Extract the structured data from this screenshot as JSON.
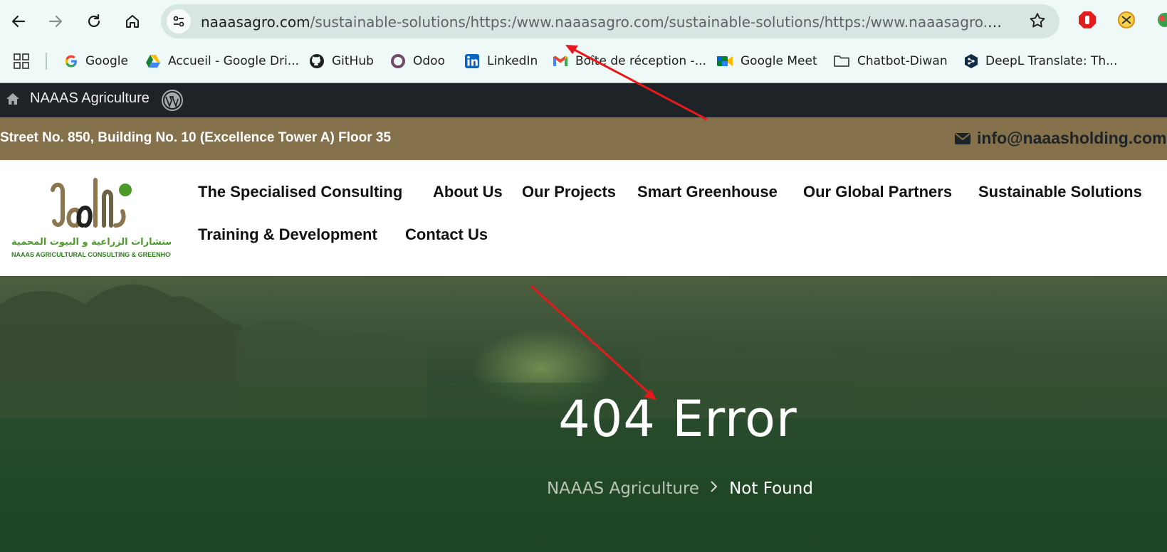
{
  "browser": {
    "url_host": "naaasagro.com",
    "url_path": "/sustainable-solutions/https:/www.naaasagro.com/sustainable-solutions/https:/www.naaasagro.com/susta...",
    "bookmarks": [
      {
        "label": "Google",
        "icon": "google-icon"
      },
      {
        "label": "Accueil - Google Dri...",
        "icon": "google-drive-icon"
      },
      {
        "label": "GitHub",
        "icon": "github-icon"
      },
      {
        "label": "Odoo",
        "icon": "odoo-icon"
      },
      {
        "label": "LinkedIn",
        "icon": "linkedin-icon"
      },
      {
        "label": "Boîte de réception -...",
        "icon": "gmail-icon"
      },
      {
        "label": "Google Meet",
        "icon": "google-meet-icon"
      },
      {
        "label": "Chatbot-Diwan",
        "icon": "folder-icon"
      },
      {
        "label": "DeepL Translate: Th...",
        "icon": "deepl-icon"
      }
    ]
  },
  "adminbar": {
    "site_name": "NAAAS Agriculture"
  },
  "topbar": {
    "address": "Street No. 850, Building No. 10 (Excellence Tower A) Floor 35",
    "email": "info@naaasholding.com"
  },
  "logo": {
    "arabic_text": "ناس للإستشارات الزراعية و البيوت المحمية",
    "english_text": "NAAAS AGRICULTURAL CONSULTING & GREENHOUSE"
  },
  "menu": [
    "The Specialised Consulting",
    "About Us",
    "Our Projects",
    "Smart Greenhouse",
    "Our Global Partners",
    "Sustainable Solutions",
    "Training & Development",
    "Contact Us"
  ],
  "hero": {
    "title": "404 Error",
    "breadcrumb_home": "NAAAS Agriculture",
    "breadcrumb_separator": ">",
    "breadcrumb_current": "Not Found"
  },
  "colors": {
    "topbar": "#85714b",
    "adminbar": "#1d2327",
    "annotation_arrow": "#e5191c",
    "logo_green": "#4c9a2a"
  }
}
